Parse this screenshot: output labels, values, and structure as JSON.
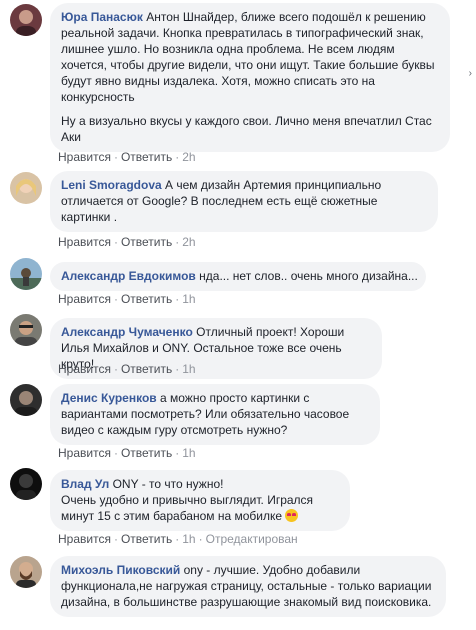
{
  "comments": [
    {
      "author": "Юра Панасюк",
      "text1": "Антон Шнайдер, ближе всего подошёл к решению реальной задачи. Кнопка превратилась в типографический знак, лишнее ушло. Но возникла одна проблема. Не всем людям хочется, чтобы другие видели, что они ищут. Такие большие буквы будут явно видны издалека. Хотя, можно списать это на конкурсность",
      "text2": "Ну а визуально вкусы у каждого свои. Лично меня впечатлил Стас Аки",
      "like": "Нравится",
      "reply": "Ответить",
      "time": "2h"
    },
    {
      "author": "Leni Smoragdova",
      "text1": "А чем дизайн Артемия принципиально отличается от Google? В последнем есть ещё сюжетные картинки .",
      "like": "Нравится",
      "reply": "Ответить",
      "time": "2h"
    },
    {
      "author": "Александр Евдокимов",
      "text1": "нда... нет слов.. очень много дизайна...",
      "like": "Нравится",
      "reply": "Ответить",
      "time": "1h"
    },
    {
      "author": "Александр Чумаченко",
      "text1": "Отличный проект! Хороши Илья Михайлов и ONY. Остальное тоже все очень круто!",
      "like": "Нравится",
      "reply": "Ответить",
      "time": "1h"
    },
    {
      "author": "Денис Куренков",
      "text1": "а можно просто картинки с вариантами посмотреть? Или обязательно часовое видео с каждым гуру отсмотреть нужно?",
      "like": "Нравится",
      "reply": "Ответить",
      "time": "1h"
    },
    {
      "author": "Влад Ул",
      "text1": "ONY - то что нужно!",
      "text2": "Очень удобно и привычно выглядит. Игрался минут 15 с этим барабаном на мобилке",
      "like": "Нравится",
      "reply": "Ответить",
      "time": "1h",
      "edited": "Отредактирован"
    },
    {
      "author": "Михоэль Пиковский",
      "text1": "ony - лучшие. Удобно добавили функционала,не нагружая страницу, остальные - только вариации дизайна, в большинстве разрушающие знакомый вид поисковика."
    }
  ],
  "colors": {
    "author": "#385898",
    "bubble": "#f2f3f5",
    "meta": "#90949c"
  },
  "scrollbar_icon": "chevron-right-icon"
}
